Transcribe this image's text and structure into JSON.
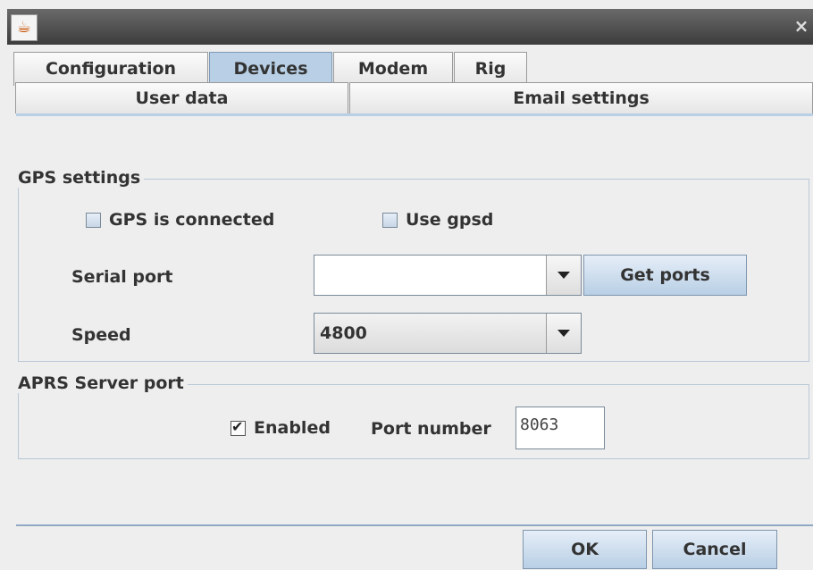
{
  "window": {
    "close_symbol": "×",
    "icon": "java-icon"
  },
  "tabs_row1": [
    {
      "label": "Configuration",
      "selected": false
    },
    {
      "label": "Devices",
      "selected": true
    },
    {
      "label": "Modem",
      "selected": false
    },
    {
      "label": "Rig",
      "selected": false
    }
  ],
  "tabs_row2": [
    {
      "label": "User data"
    },
    {
      "label": "Email settings"
    }
  ],
  "gps": {
    "title": "GPS settings",
    "connected_label": "GPS is connected",
    "connected_checked": false,
    "gpsd_label": "Use gpsd",
    "gpsd_checked": false,
    "serial_port_label": "Serial port",
    "serial_port_value": "",
    "get_ports_label": "Get ports",
    "speed_label": "Speed",
    "speed_value": "4800"
  },
  "aprs": {
    "title": "APRS Server port",
    "enabled_label": "Enabled",
    "enabled_checked": true,
    "port_label": "Port number",
    "port_value": "8063"
  },
  "buttons": {
    "ok": "OK",
    "cancel": "Cancel"
  },
  "colors": {
    "selected_tab": "#b8cfe5",
    "titlebar": "#4a4a4a"
  }
}
